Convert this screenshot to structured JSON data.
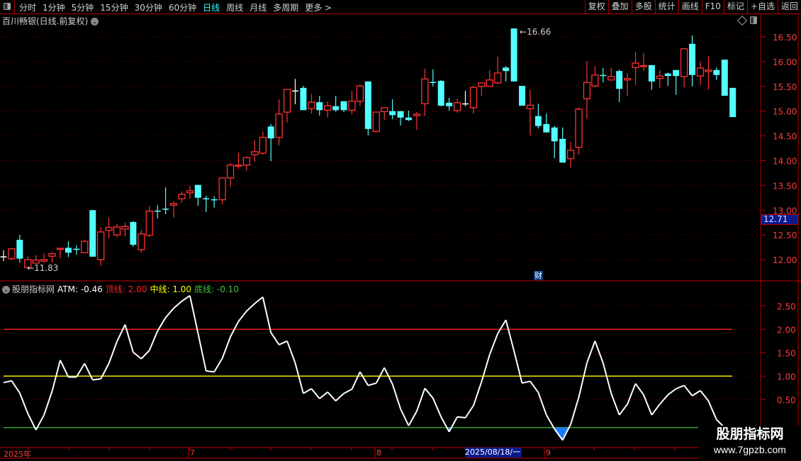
{
  "toolbar": {
    "periods": [
      "分时",
      "1分钟",
      "5分钟",
      "15分钟",
      "30分钟",
      "60分钟",
      "日线",
      "周线",
      "月线",
      "多周期",
      "更多 >"
    ],
    "active_period": "日线",
    "right_buttons": [
      "复权",
      "叠加",
      "多股",
      "统计",
      "画线",
      "F10",
      "标记",
      "+自选",
      "返回"
    ]
  },
  "stock": {
    "title": "百川畅银(日线.前复权)"
  },
  "price_axis": {
    "ticks": [
      "12.00",
      "12.50",
      "13.00",
      "13.50",
      "14.00",
      "14.50",
      "15.00",
      "15.50",
      "16.00",
      "16.50"
    ],
    "current_label": "12.71"
  },
  "annotations": {
    "high_label": "16.66",
    "low_label": "11.83",
    "finance_marker": "财"
  },
  "indicator": {
    "name": "股朋指标网",
    "atm": "ATM: -0.46",
    "top_line": "顶线: 2.00",
    "mid_line": "中线: 1.00",
    "bottom_line": "底线: -0.10",
    "axis_ticks": [
      "0.50",
      "1.00",
      "1.50",
      "2.00",
      "2.50"
    ]
  },
  "date_axis": {
    "labels": [
      "2025年",
      "7",
      "8",
      "9"
    ],
    "highlight": "2025/08/18/一"
  },
  "watermark": {
    "name": "股朋指标网",
    "url": "www.7gpzb.com"
  },
  "colors": {
    "up": "#ff3232",
    "down": "#54ffff",
    "flat": "#ffffff",
    "top_line": "#ff2020",
    "mid_line": "#ffff00",
    "bottom_line": "#40c040",
    "axis": "#ff3c3c",
    "fill_below": "#1a7fff"
  },
  "chart_data": [
    {
      "type": "candlestick",
      "ylim": [
        11.7,
        16.8
      ],
      "fields": [
        "open",
        "high",
        "low",
        "close"
      ],
      "ohlc": [
        [
          12.06,
          12.19,
          11.97,
          12.06
        ],
        [
          12.02,
          12.22,
          11.99,
          12.22
        ],
        [
          12.4,
          12.5,
          11.94,
          12.02
        ],
        [
          11.84,
          12.07,
          11.83,
          12.0
        ],
        [
          11.93,
          12.09,
          11.92,
          11.99
        ],
        [
          11.97,
          12.12,
          11.94,
          12.0
        ],
        [
          12.07,
          12.16,
          11.94,
          12.12
        ],
        [
          12.22,
          12.23,
          12.03,
          12.23
        ],
        [
          12.24,
          12.37,
          12.05,
          12.14
        ],
        [
          12.22,
          12.29,
          12.1,
          12.21
        ],
        [
          12.14,
          12.4,
          12.14,
          12.37
        ],
        [
          13.0,
          13.0,
          12.06,
          12.06
        ],
        [
          12.0,
          12.66,
          11.87,
          12.56
        ],
        [
          12.59,
          12.85,
          12.43,
          12.65
        ],
        [
          12.5,
          12.72,
          12.45,
          12.66
        ],
        [
          12.62,
          12.75,
          12.47,
          12.67
        ],
        [
          12.76,
          12.78,
          12.26,
          12.3
        ],
        [
          12.2,
          12.6,
          12.14,
          12.52
        ],
        [
          12.49,
          13.08,
          12.46,
          12.98
        ],
        [
          12.99,
          13.1,
          12.83,
          12.98
        ],
        [
          13.03,
          13.46,
          12.92,
          13.02
        ],
        [
          13.1,
          13.18,
          12.85,
          13.13
        ],
        [
          13.23,
          13.38,
          13.15,
          13.32
        ],
        [
          13.35,
          13.49,
          13.23,
          13.39
        ],
        [
          13.51,
          13.51,
          13.09,
          13.25
        ],
        [
          13.24,
          13.29,
          12.96,
          13.23
        ],
        [
          13.22,
          13.28,
          13.05,
          13.21
        ],
        [
          13.21,
          13.65,
          13.12,
          13.65
        ],
        [
          13.65,
          13.95,
          13.48,
          13.91
        ],
        [
          13.9,
          14.16,
          13.83,
          13.91
        ],
        [
          13.91,
          14.09,
          13.79,
          14.06
        ],
        [
          14.12,
          14.41,
          13.98,
          14.18
        ],
        [
          14.15,
          14.59,
          14.12,
          14.47
        ],
        [
          14.69,
          14.74,
          13.99,
          14.45
        ],
        [
          14.47,
          15.24,
          14.31,
          14.94
        ],
        [
          14.98,
          15.44,
          14.77,
          15.44
        ],
        [
          15.41,
          15.65,
          15.14,
          15.41
        ],
        [
          15.47,
          15.51,
          15.02,
          15.02
        ],
        [
          15.05,
          15.35,
          14.95,
          15.18
        ],
        [
          15.18,
          15.31,
          14.91,
          15.02
        ],
        [
          15.02,
          15.2,
          14.87,
          15.11
        ],
        [
          15.1,
          15.31,
          14.99,
          15.02
        ],
        [
          15.2,
          15.2,
          14.98,
          15.02
        ],
        [
          15.02,
          15.41,
          14.94,
          15.2
        ],
        [
          15.2,
          15.54,
          15.1,
          15.51
        ],
        [
          15.6,
          15.6,
          14.51,
          14.64
        ],
        [
          14.59,
          14.99,
          14.57,
          14.98
        ],
        [
          14.99,
          15.07,
          14.82,
          15.07
        ],
        [
          15.0,
          15.24,
          14.84,
          14.92
        ],
        [
          15.0,
          15.0,
          14.71,
          14.87
        ],
        [
          14.87,
          15.01,
          14.8,
          14.82
        ],
        [
          14.91,
          14.98,
          14.62,
          14.94
        ],
        [
          15.15,
          15.86,
          14.9,
          15.65
        ],
        [
          15.59,
          15.84,
          15.5,
          15.58
        ],
        [
          15.61,
          15.63,
          15.1,
          15.11
        ],
        [
          15.17,
          15.27,
          15.01,
          15.1
        ],
        [
          15.01,
          15.25,
          14.97,
          15.17
        ],
        [
          15.15,
          15.41,
          15.1,
          15.15
        ],
        [
          15.07,
          15.51,
          14.95,
          15.48
        ],
        [
          15.5,
          15.57,
          15.31,
          15.57
        ],
        [
          15.5,
          15.83,
          15.5,
          15.63
        ],
        [
          15.57,
          16.1,
          15.54,
          15.77
        ],
        [
          15.88,
          15.91,
          15.6,
          15.81
        ],
        [
          16.67,
          16.67,
          15.6,
          15.6
        ],
        [
          15.51,
          15.51,
          15.11,
          15.11
        ],
        [
          15.05,
          15.43,
          14.51,
          15.12
        ],
        [
          14.9,
          15.15,
          14.65,
          14.7
        ],
        [
          14.74,
          14.95,
          14.57,
          14.57
        ],
        [
          14.67,
          14.7,
          14.05,
          14.39
        ],
        [
          14.44,
          14.67,
          13.96,
          13.96
        ],
        [
          14.04,
          14.38,
          13.86,
          14.21
        ],
        [
          14.27,
          15.08,
          14.12,
          15.04
        ],
        [
          15.25,
          16.01,
          14.84,
          15.58
        ],
        [
          15.51,
          15.91,
          15.48,
          15.73
        ],
        [
          15.73,
          15.87,
          15.58,
          15.72
        ],
        [
          15.63,
          15.88,
          15.63,
          15.7
        ],
        [
          15.81,
          15.84,
          15.18,
          15.45
        ],
        [
          15.63,
          15.77,
          15.31,
          15.66
        ],
        [
          15.88,
          16.2,
          15.53,
          15.97
        ],
        [
          15.91,
          16.17,
          15.81,
          15.92
        ],
        [
          15.93,
          15.93,
          15.43,
          15.6
        ],
        [
          15.66,
          15.83,
          15.47,
          15.71
        ],
        [
          15.76,
          15.78,
          15.51,
          15.71
        ],
        [
          15.83,
          15.83,
          15.33,
          15.71
        ],
        [
          15.7,
          16.26,
          15.48,
          16.26
        ],
        [
          16.36,
          16.53,
          15.5,
          15.73
        ],
        [
          15.71,
          16.0,
          15.53,
          15.87
        ],
        [
          15.8,
          16.11,
          15.43,
          15.83
        ],
        [
          15.83,
          15.88,
          15.63,
          15.73
        ],
        [
          16.04,
          16.04,
          15.31,
          15.31
        ],
        [
          15.47,
          15.47,
          14.88,
          14.88
        ]
      ]
    },
    {
      "type": "line",
      "series": [
        {
          "name": "ATM",
          "values": [
            0.86,
            0.9,
            0.64,
            0.2,
            -0.15,
            0.17,
            0.68,
            1.34,
            0.98,
            0.98,
            1.27,
            0.92,
            0.94,
            1.27,
            1.74,
            2.1,
            1.51,
            1.37,
            1.55,
            1.96,
            2.25,
            2.45,
            2.6,
            2.72,
            1.92,
            1.11,
            1.09,
            1.38,
            1.84,
            2.17,
            2.39,
            2.55,
            2.69,
            1.93,
            1.67,
            1.75,
            1.28,
            0.63,
            0.73,
            0.52,
            0.66,
            0.47,
            0.63,
            0.72,
            1.09,
            0.8,
            0.85,
            1.18,
            0.83,
            0.3,
            -0.06,
            0.25,
            0.74,
            0.53,
            0.13,
            -0.19,
            0.13,
            0.11,
            0.37,
            0.88,
            1.46,
            1.91,
            2.2,
            1.54,
            0.85,
            0.89,
            0.65,
            0.17,
            -0.13,
            -0.37,
            -0.03,
            0.55,
            1.28,
            1.75,
            1.28,
            0.63,
            0.17,
            0.4,
            0.84,
            0.6,
            0.17,
            0.4,
            0.6,
            0.73,
            0.8,
            0.58,
            0.69,
            0.47,
            0.07,
            -0.1,
            -0.46
          ]
        }
      ],
      "reference_lines": [
        2.0,
        1.0,
        -0.1
      ],
      "ylim": [
        -0.5,
        2.9
      ]
    }
  ]
}
